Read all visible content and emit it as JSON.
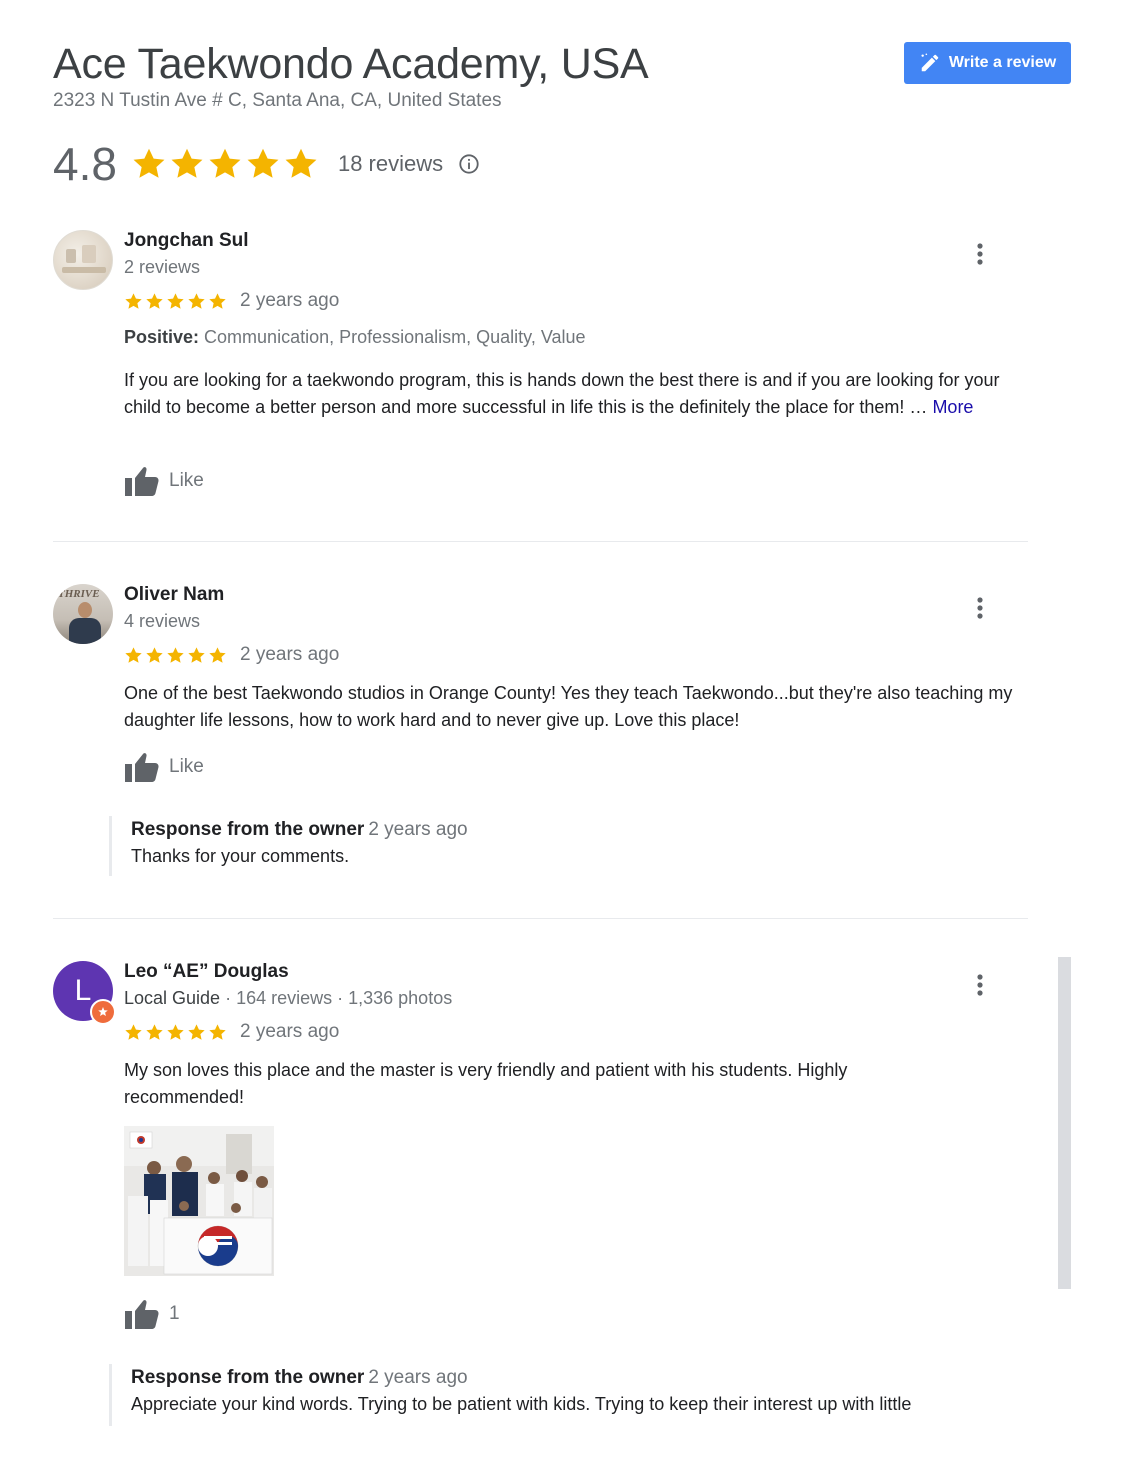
{
  "header": {
    "title": "Ace Taekwondo Academy, USA",
    "address": "2323 N Tustin Ave # C, Santa Ana, CA, United States",
    "write_review_label": "Write a review"
  },
  "summary": {
    "rating": "4.8",
    "stars": 5,
    "reviews_count": "18 reviews"
  },
  "colors": {
    "star": "#f4b400",
    "button": "#4285f4",
    "link": "#1a0dab"
  },
  "reviews": [
    {
      "name": "Jongchan Sul",
      "meta": "2 reviews",
      "stars": 5,
      "time": "2 years ago",
      "positive_label": "Positive:",
      "positive_values": "Communication, Professionalism, Quality, Value",
      "text": "If you are looking for a taekwondo program, this is hands down the best there is and if you are looking for your child to become a better person and more successful in life this is the definitely the place for them! …",
      "more_label": "More",
      "like_label": "Like"
    },
    {
      "name": "Oliver Nam",
      "meta": "4 reviews",
      "stars": 5,
      "time": "2 years ago",
      "text": "One of the best Taekwondo studios in Orange County! Yes they teach Taekwondo...but they're also teaching my daughter life lessons, how to work hard and to never give up. Love this place!",
      "like_label": "Like",
      "owner_response": {
        "label": "Response from the owner",
        "time": "2 years ago",
        "text": "Thanks for your comments."
      }
    },
    {
      "name": "Leo “AE” Douglas",
      "avatar_letter": "L",
      "meta_local_guide": "Local Guide",
      "meta_rest": " · 164 reviews · 1,336 photos",
      "stars": 5,
      "time": "2 years ago",
      "text": "My son loves this place and the master is very friendly and patient with his students. Highly recommended!",
      "like_count": "1",
      "owner_response": {
        "label": "Response from the owner",
        "time": "2 years ago",
        "text": "Appreciate your kind words. Trying to be patient with kids. Trying to keep their interest up with little"
      }
    }
  ]
}
